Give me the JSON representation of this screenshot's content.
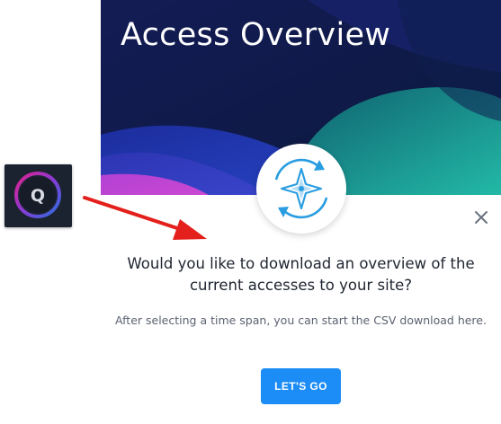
{
  "launcher": {
    "icon": "q-logo-icon",
    "letter": "Q"
  },
  "modal": {
    "title": "Access Overview",
    "emblem_icon": "compass-refresh-icon",
    "close_icon": "close-icon",
    "headline": "Would you like to download an overview of the current accesses to your site?",
    "description": "After selecting a time span, you can start the CSV download here.",
    "primary_button_label": "LET'S GO"
  },
  "annotation": {
    "arrow_color": "#e3201b"
  },
  "colors": {
    "accent": "#1c8cf7",
    "hero_dark_blue": "#111a4a",
    "hero_teal": "#1fb3a8",
    "hero_magenta": "#c845d4"
  }
}
